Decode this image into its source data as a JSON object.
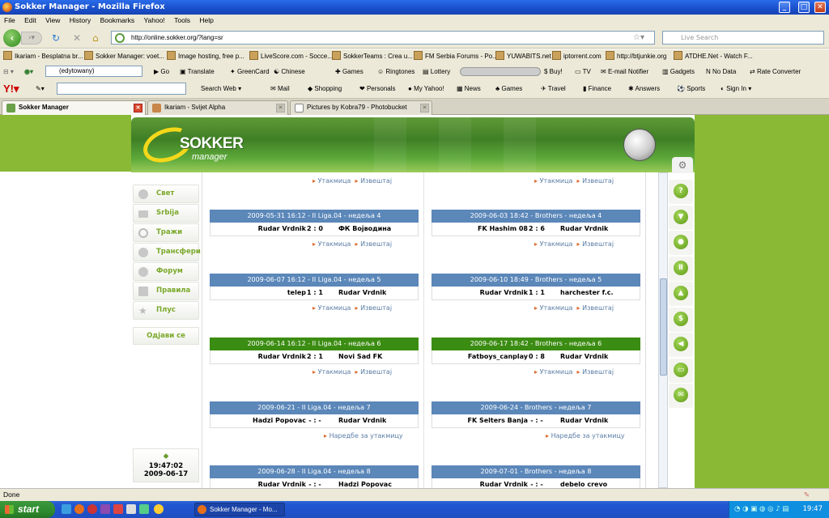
{
  "window": {
    "title": "Sokker Manager - Mozilla Firefox"
  },
  "menu": [
    "File",
    "Edit",
    "View",
    "History",
    "Bookmarks",
    "Yahoo!",
    "Tools",
    "Help"
  ],
  "url": "http://online.sokker.org/?lang=sr",
  "search_placeholder": "Live Search",
  "bookmarks": [
    "Ikariam - Besplatna br...",
    "Sokker Manager: voet...",
    "Image hosting, free p...",
    "LiveScore.com - Socce...",
    "SokkerTeams : Crea u...",
    "FM Serbia Forums - Po...",
    "YUWABITS.net",
    "iptorrent.com",
    "http://btjunkie.org",
    "ATDHE.Net - Watch F..."
  ],
  "toolbar2": {
    "field": "(edytowany)",
    "items": [
      "Go",
      "Translate",
      "GreenCard",
      "Chinese",
      "Games",
      "Ringtones",
      "Lottery",
      "Buy!",
      "TV",
      "E-mail Notifier",
      "Gadgets",
      "No Data",
      "Rate Converter"
    ]
  },
  "toolbar3": {
    "search_web": "Search Web",
    "items": [
      "Mail",
      "Shopping",
      "Personals",
      "My Yahoo!",
      "News",
      "Games",
      "Travel",
      "Finance",
      "Answers",
      "Sports",
      "Sign In"
    ]
  },
  "tabs": [
    "Sokker Manager",
    "Ikariam - Svijet Alpha",
    "Pictures by Kobra79 - Photobucket"
  ],
  "brand": {
    "name": "SOKKER",
    "sub": "manager"
  },
  "sidebar": [
    "Свет",
    "Srbija",
    "Тражи",
    "Трансфери",
    "Форум",
    "Правила",
    "Плус"
  ],
  "logout": "Одјави се",
  "clock": {
    "time": "19:47:02",
    "date": "2009-06-17"
  },
  "top_links": {
    "match": "Утакмица",
    "report": "Извештај"
  },
  "matches_left": [
    {
      "header": "2009-05-31 16:12 - II Liga.04 - недеља 4",
      "home": "Rudar Vrdnik",
      "score": "2 : 0",
      "away": "ФК Војводина",
      "links": [
        "Утакмица",
        "Извештај"
      ],
      "color": "blue"
    },
    {
      "header": "2009-06-07 16:12 - II Liga.04 - недеља 5",
      "home": "telep",
      "score": "1 : 1",
      "away": "Rudar Vrdnik",
      "links": [
        "Утакмица",
        "Извештај"
      ],
      "color": "blue"
    },
    {
      "header": "2009-06-14 16:12 - II Liga.04 - недеља 6",
      "home": "Rudar Vrdnik",
      "score": "2 : 1",
      "away": "Novi Sad FK",
      "links": [
        "Утакмица",
        "Извештај"
      ],
      "color": "green"
    },
    {
      "header": "2009-06-21 - II Liga.04 - недеља 7",
      "home": "Hadzi Popovac",
      "score": "- : -",
      "away": "Rudar Vrdnik",
      "links": [
        "Наредбе за утакмицу"
      ],
      "color": "blue"
    },
    {
      "header": "2009-06-28 - II Liga.04 - недеља 8",
      "home": "Rudar Vrdnik",
      "score": "- : -",
      "away": "Hadzi Popovac",
      "links": [],
      "color": "blue"
    }
  ],
  "matches_right": [
    {
      "header": "2009-06-03 18:42 - Brothers - недеља 4",
      "home": "FK Hashim 08",
      "score": "2 : 6",
      "away": "Rudar Vrdnik",
      "links": [
        "Утакмица",
        "Извештај"
      ],
      "color": "blue"
    },
    {
      "header": "2009-06-10 18:49 - Brothers - недеља 5",
      "home": "Rudar Vrdnik",
      "score": "1 : 1",
      "away": "harchester f.c.",
      "links": [
        "Утакмица",
        "Извештај"
      ],
      "color": "blue"
    },
    {
      "header": "2009-06-17 18:42 - Brothers - недеља 6",
      "home": "Fatboys_canplay",
      "score": "0 : 8",
      "away": "Rudar Vrdnik",
      "links": [
        "Утакмица",
        "Извештај"
      ],
      "color": "green"
    },
    {
      "header": "2009-06-24 - Brothers - недеља 7",
      "home": "FK Selters Banja",
      "score": "- : -",
      "away": "Rudar Vrdnik",
      "links": [
        "Наредбе за утакмицу"
      ],
      "color": "blue"
    },
    {
      "header": "2009-07-01 - Brothers - недеља 8",
      "home": "Rudar Vrdnik",
      "score": "- : -",
      "away": "debelo crevo",
      "links": [],
      "color": "blue"
    }
  ],
  "status": "Done",
  "taskbar": {
    "start": "start",
    "item": "Sokker Manager - Mo...",
    "time": "19:47"
  }
}
